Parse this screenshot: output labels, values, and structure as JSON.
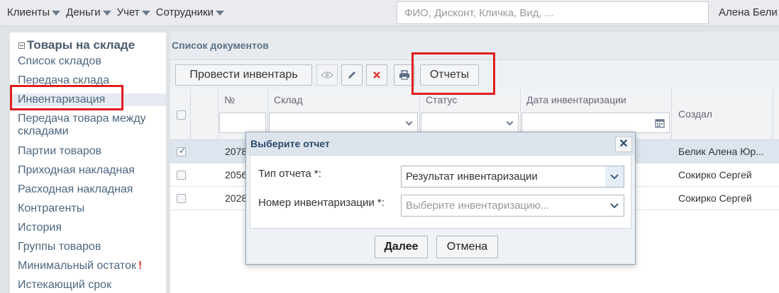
{
  "topnav": {
    "items": [
      {
        "label": "Клиенты"
      },
      {
        "label": "Деньги"
      },
      {
        "label": "Учет"
      },
      {
        "label": "Сотрудники"
      }
    ],
    "search_placeholder": "ФИО, Дисконт, Кличка, Вид, ...",
    "user": "Алена Бели"
  },
  "sidebar": {
    "title": "Товары на складе",
    "items": [
      {
        "label": "Список складов"
      },
      {
        "label": "Передача склада"
      },
      {
        "label": "Инвентаризация"
      },
      {
        "label": "Передача товара между"
      },
      {
        "label": "складами"
      },
      {
        "label": "Партии товаров"
      },
      {
        "label": "Приходная накладная"
      },
      {
        "label": "Расходная накладная"
      },
      {
        "label": "Контрагенты"
      },
      {
        "label": "История"
      },
      {
        "label": "Группы товаров"
      },
      {
        "label": "Минимальный остаток"
      },
      {
        "label": "Истекающий срок"
      }
    ],
    "alert_mark": "!"
  },
  "main": {
    "title": "Список документов",
    "toolbar": {
      "inventory_button": "Провести инвентарь",
      "reports_button": "Отчеты"
    },
    "grid": {
      "columns": [
        "№",
        "Склад",
        "Статус",
        "Дата инвентаризации",
        "Создал"
      ],
      "rows": [
        {
          "num": "2078",
          "creator": "Белик Алена Юр...",
          "checked": true
        },
        {
          "num": "2056",
          "creator": "Сокирко Сергей",
          "checked": false
        },
        {
          "num": "2028",
          "creator": "Сокирко Сергей",
          "checked": false
        }
      ]
    }
  },
  "dialog": {
    "title": "Выберите отчет",
    "report_type_label": "Тип отчета *:",
    "report_type_value": "Результат инвентаризации",
    "inventory_number_label": "Номер инвентаризации *:",
    "inventory_number_placeholder": "Выберите инвентаризацию...",
    "next_button": "Далее",
    "cancel_button": "Отмена"
  },
  "colors": {
    "highlight": "#e01e1e",
    "accent": "#2b4a6b",
    "delete": "#e53935"
  }
}
